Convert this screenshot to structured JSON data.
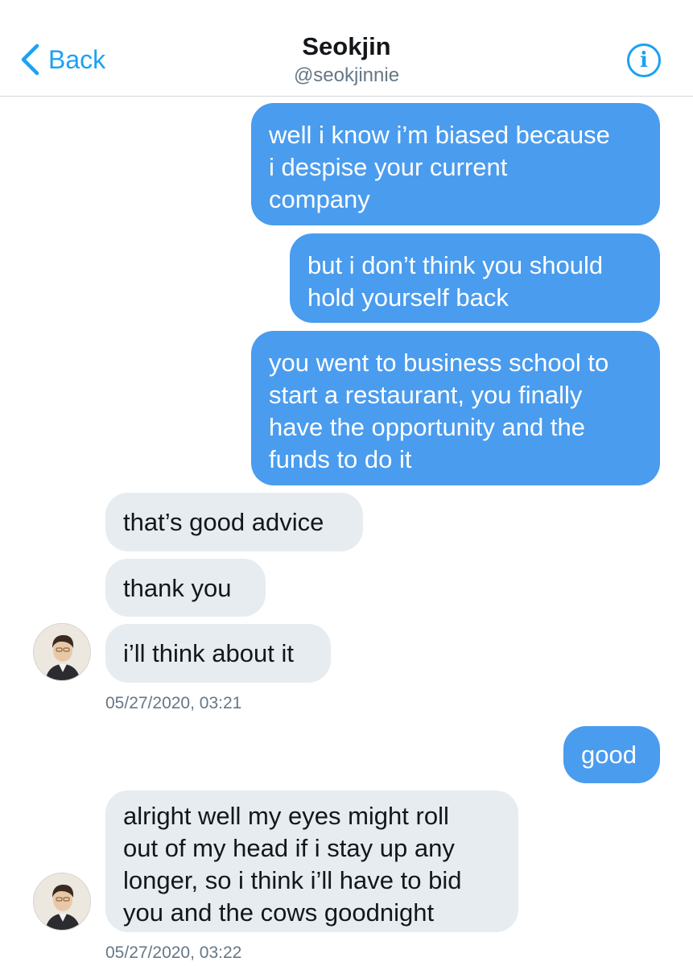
{
  "header": {
    "back_label": "Back",
    "name": "Seokjin",
    "handle": "@seokjinnie",
    "info_icon": "info-icon",
    "accent_color": "#1da1f2"
  },
  "messages": [
    {
      "from": "me",
      "text": "well i know i’m biased because\ni despise your current\ncompany"
    },
    {
      "from": "me",
      "text": "but i don’t think you should\nhold yourself back"
    },
    {
      "from": "me",
      "text": "you went to business school to\nstart a restaurant, you finally\nhave the opportunity and the\nfunds to do it"
    },
    {
      "from": "them",
      "text": "that’s good advice"
    },
    {
      "from": "them",
      "text": "thank you"
    },
    {
      "from": "them",
      "text": "i’ll think about it"
    },
    {
      "from": "me",
      "text": "good"
    },
    {
      "from": "them",
      "text": "alright well my eyes might roll\nout of my head if i stay up any\nlonger, so i think i’ll have to bid\nyou and the cows goodnight"
    }
  ],
  "timestamps": [
    "05/27/2020, 03:21",
    "05/27/2020, 03:22"
  ],
  "colors": {
    "sent_bubble": "#4a9cee",
    "received_bubble": "#e6ecf0"
  }
}
